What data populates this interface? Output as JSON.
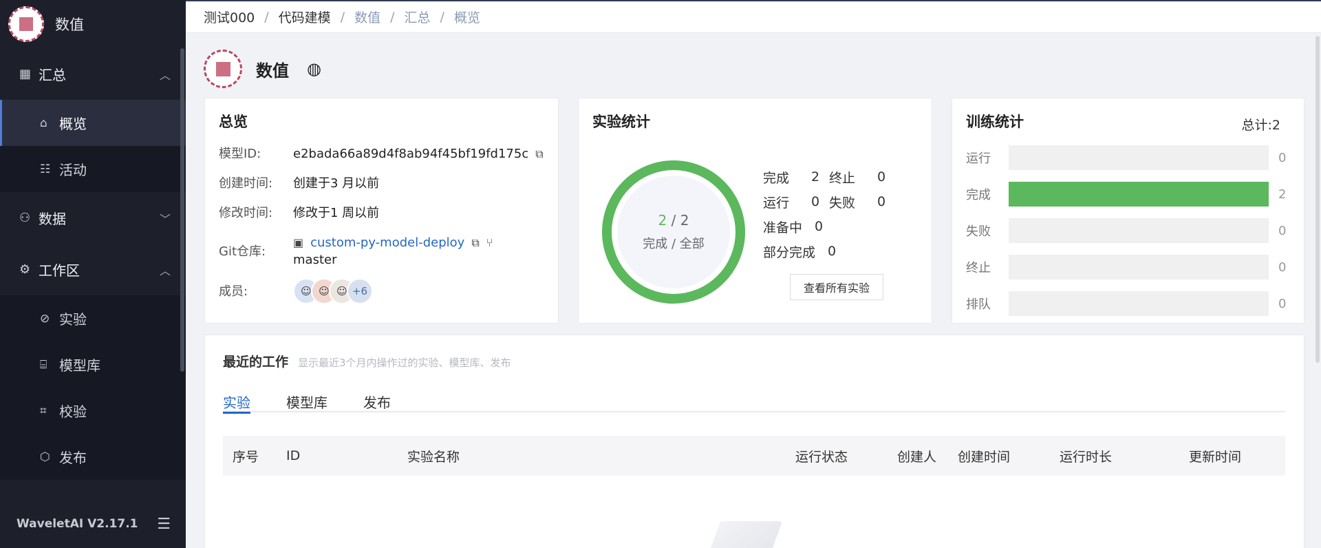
{
  "sidebar": {
    "app_name": "数值",
    "groups": [
      {
        "label": "汇总",
        "icon": "grid-icon",
        "expanded": true,
        "items": [
          {
            "label": "概览",
            "icon": "home-icon",
            "active": true
          },
          {
            "label": "活动",
            "icon": "activity-icon",
            "active": false
          }
        ]
      },
      {
        "label": "数据",
        "icon": "hierarchy-icon",
        "expanded": false,
        "items": []
      },
      {
        "label": "工作区",
        "icon": "gear-icon",
        "expanded": true,
        "items": [
          {
            "label": "实验",
            "icon": "experiment-icon"
          },
          {
            "label": "模型库",
            "icon": "model-library-icon"
          },
          {
            "label": "校验",
            "icon": "scan-icon"
          },
          {
            "label": "发布",
            "icon": "cube-icon"
          }
        ]
      }
    ],
    "version": "WaveletAI V2.17.1"
  },
  "breadcrumb": [
    "测试000",
    "代码建模",
    "数值",
    "汇总",
    "概览"
  ],
  "header": {
    "title": "数值",
    "globe_icon": "globe-icon"
  },
  "overview": {
    "title": "总览",
    "model_id_label": "模型ID:",
    "model_id": "e2bada66a89d4f8ab94f45bf19fd175c",
    "created_label": "创建时间:",
    "created": "创建于3 月以前",
    "modified_label": "修改时间:",
    "modified": "修改于1 周以前",
    "git_label": "Git仓库:",
    "git_repo": "custom-py-model-deploy",
    "git_branch": "master",
    "members_label": "成员:",
    "members_more": "+6"
  },
  "experiment_stats": {
    "title": "实验统计",
    "done": "2",
    "total": "2",
    "ring_sub": "完成 / 全部",
    "ring_fraction": 1.0,
    "complete_label": "完成",
    "complete": "2",
    "stopped_label": "终止",
    "stopped": "0",
    "running_label": "运行",
    "running": "0",
    "failed_label": "失败",
    "failed": "0",
    "preparing_label": "准备中",
    "preparing": "0",
    "partial_label": "部分完成",
    "partial": "0",
    "view_all": "查看所有实验",
    "ring_color": "#5cb85c"
  },
  "training_stats": {
    "title": "训练统计",
    "total": "总计:2",
    "max": 2,
    "bars": [
      {
        "label": "运行",
        "value": 0
      },
      {
        "label": "完成",
        "value": 2
      },
      {
        "label": "失败",
        "value": 0
      },
      {
        "label": "终止",
        "value": 0
      },
      {
        "label": "排队",
        "value": 0
      }
    ],
    "bar_color": "#5cb85c"
  },
  "recent_work": {
    "title": "最近的工作",
    "desc": "显示最近3个月内操作过的实验、模型库、发布",
    "tabs": [
      "实验",
      "模型库",
      "发布"
    ],
    "columns": [
      "序号",
      "ID",
      "实验名称",
      "运行状态",
      "创建人",
      "创建时间",
      "运行时长",
      "更新时间"
    ]
  }
}
